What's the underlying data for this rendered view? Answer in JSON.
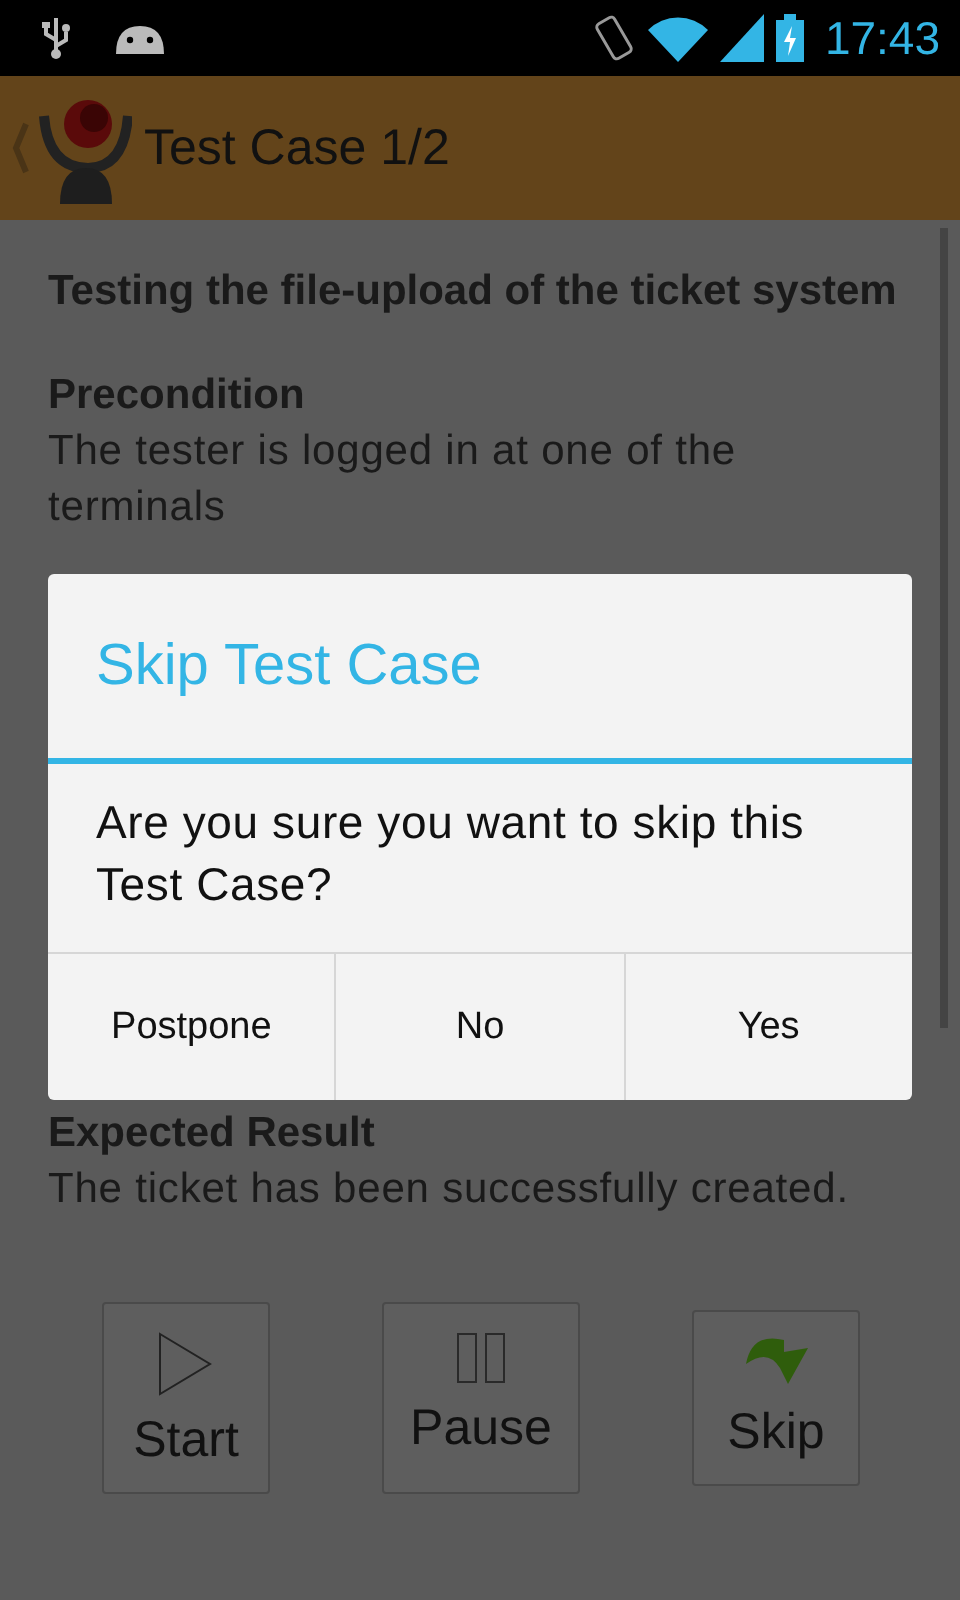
{
  "status_bar": {
    "time": "17:43"
  },
  "action_bar": {
    "title": "Test Case 1/2"
  },
  "test_case": {
    "title": "Testing the file-upload of the ticket system",
    "sections": [
      {
        "heading": "Precondition",
        "text": "The tester is logged in at one of the terminals"
      },
      {
        "heading": "Expected Result",
        "text": "The ticket has been successfully created."
      }
    ]
  },
  "controls": [
    {
      "kind": "play",
      "label": "Start"
    },
    {
      "kind": "pause",
      "label": "Pause"
    },
    {
      "kind": "skip",
      "label": "Skip"
    }
  ],
  "dialog": {
    "title": "Skip Test Case",
    "message": "Are you sure you want to skip this Test Case?",
    "buttons": [
      "Postpone",
      "No",
      "Yes"
    ]
  }
}
